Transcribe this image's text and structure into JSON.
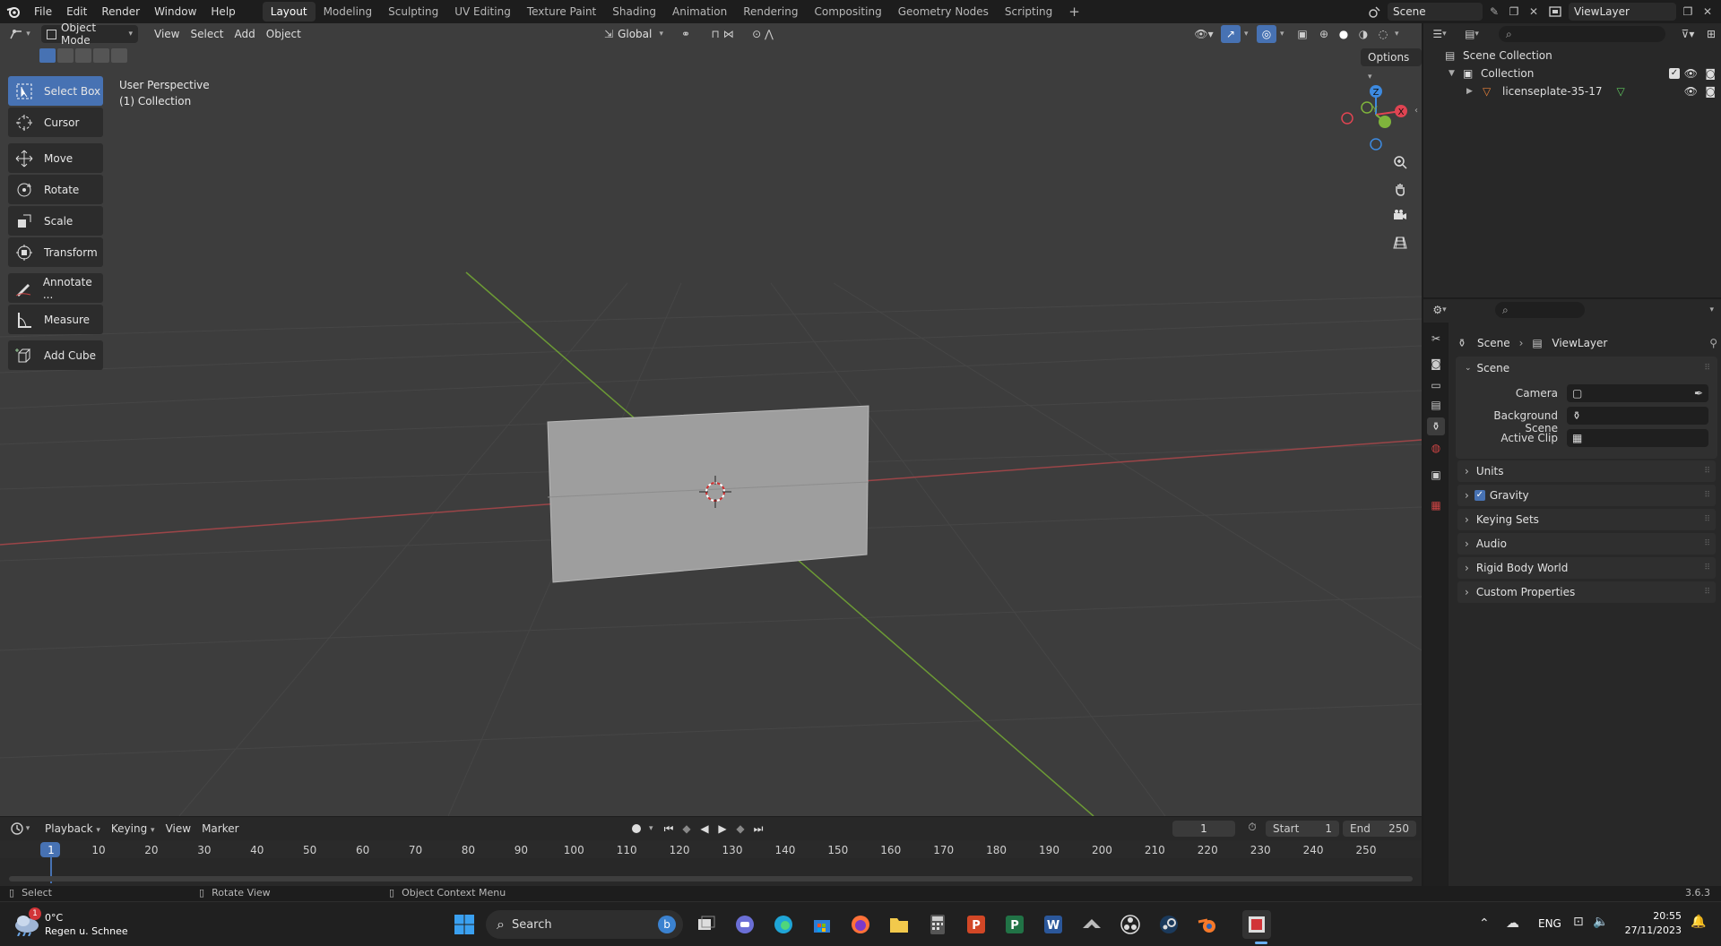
{
  "topbar": {
    "menus": [
      "File",
      "Edit",
      "Render",
      "Window",
      "Help"
    ],
    "workspaces": [
      "Layout",
      "Modeling",
      "Sculpting",
      "UV Editing",
      "Texture Paint",
      "Shading",
      "Animation",
      "Rendering",
      "Compositing",
      "Geometry Nodes",
      "Scripting"
    ],
    "active_workspace": "Layout",
    "add_workspace": "+",
    "scene_name": "Scene",
    "view_layer_name": "ViewLayer"
  },
  "viewport": {
    "mode": "Object Mode",
    "menus": [
      "View",
      "Select",
      "Add",
      "Object"
    ],
    "orientation": "Global",
    "options_label": "Options",
    "overlay_title": "User Perspective",
    "overlay_collection": "(1) Collection",
    "gizmo_axes": {
      "x": "X",
      "y": "Y",
      "z": "Z"
    },
    "colors": {
      "x_axis": "#e04452",
      "y_axis": "#7fb43c",
      "z_axis": "#3d8ae0",
      "background": "#3d3d3d",
      "active_tool": "#4772b3"
    }
  },
  "toolbar": {
    "tools": [
      {
        "label": "Select Box",
        "icon": "select-box-icon",
        "active": true
      },
      {
        "label": "Cursor",
        "icon": "cursor-icon"
      },
      {
        "label": "Move",
        "icon": "move-icon"
      },
      {
        "label": "Rotate",
        "icon": "rotate-icon"
      },
      {
        "label": "Scale",
        "icon": "scale-icon"
      },
      {
        "label": "Transform",
        "icon": "transform-icon"
      },
      {
        "label": "Annotate ...",
        "icon": "annotate-icon"
      },
      {
        "label": "Measure",
        "icon": "measure-icon"
      },
      {
        "label": "Add Cube",
        "icon": "add-cube-icon"
      }
    ]
  },
  "timeline": {
    "menus": [
      "Playback",
      "Keying",
      "View",
      "Marker"
    ],
    "current_frame": "1",
    "start_label": "Start",
    "start_value": "1",
    "end_label": "End",
    "end_value": "250",
    "ruler_labels": [
      "1",
      "10",
      "20",
      "30",
      "40",
      "50",
      "60",
      "70",
      "80",
      "90",
      "100",
      "110",
      "120",
      "130",
      "140",
      "150",
      "160",
      "170",
      "180",
      "190",
      "200",
      "210",
      "220",
      "230",
      "240",
      "250"
    ]
  },
  "statusbar": {
    "select": "Select",
    "rotate_view": "Rotate View",
    "context_menu": "Object Context Menu",
    "version": "3.6.3"
  },
  "outliner": {
    "scene_collection": "Scene Collection",
    "collection": "Collection",
    "object": "licenseplate-35-17"
  },
  "properties": {
    "breadcrumb_scene": "Scene",
    "breadcrumb_view_layer": "ViewLayer",
    "scene_panel": "Scene",
    "camera_label": "Camera",
    "background_scene_label": "Background Scene",
    "active_clip_label": "Active Clip",
    "sections": [
      "Units",
      "Gravity",
      "Keying Sets",
      "Audio",
      "Rigid Body World",
      "Custom Properties"
    ],
    "gravity_checked": true
  },
  "taskbar": {
    "weather_badge": "1",
    "weather_temp": "0°C",
    "weather_desc": "Regen u. Schnee",
    "search_label": "Search",
    "language": "ENG",
    "time": "20:55",
    "date": "27/11/2023"
  }
}
